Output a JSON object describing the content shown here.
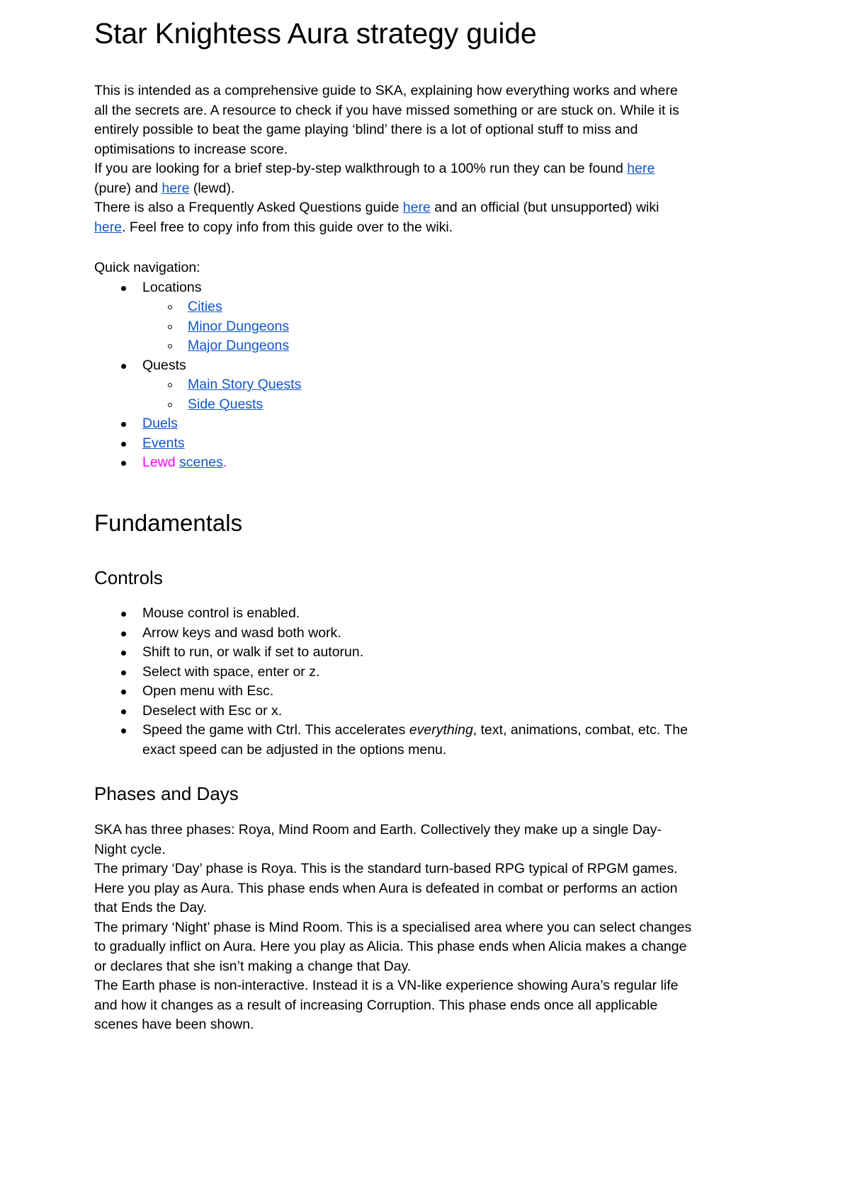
{
  "document": {
    "title": "Star Knightess Aura strategy guide",
    "intro": {
      "paragraph1": "This is intended as a comprehensive guide to SKA, explaining how everything works and where all the secrets are. A resource to check if you have missed something or are stuck on. While it is entirely possible to beat the game playing ‘blind’ there is a lot of optional stuff to miss and optimisations to increase score.",
      "walkthrough_pre": "If you are looking for a brief step-by-step walkthrough to a 100% run they can be found ",
      "walkthrough_link1": "here",
      "walkthrough_mid": " (pure) and ",
      "walkthrough_link2": "here",
      "walkthrough_post": " (lewd).",
      "faq_pre": "There is also a Frequently Asked Questions guide ",
      "faq_link": "here",
      "faq_mid": " and an official (but unsupported) wiki ",
      "wiki_link": "here",
      "faq_post": ". Feel free to copy info from this guide over to the wiki."
    },
    "quick_navigation": {
      "label": "Quick navigation:",
      "items": [
        {
          "label": "Locations",
          "is_link": false,
          "children": [
            {
              "label": "Cities",
              "is_link": true
            },
            {
              "label": "Minor Dungeons",
              "is_link": true
            },
            {
              "label": "Major Dungeons",
              "is_link": true
            }
          ]
        },
        {
          "label": "Quests",
          "is_link": false,
          "children": [
            {
              "label": "Main Story Quests",
              "is_link": true
            },
            {
              "label": "Side Quests",
              "is_link": true
            }
          ]
        },
        {
          "label": "Duels",
          "is_link": true,
          "children": []
        },
        {
          "label": "Events",
          "is_link": true,
          "children": []
        }
      ],
      "lewd_item": {
        "prefix": "Lewd ",
        "link": "scenes",
        "suffix": "."
      }
    },
    "fundamentals": {
      "heading": "Fundamentals",
      "controls": {
        "heading": "Controls",
        "items": [
          "Mouse control is enabled.",
          "Arrow keys and wasd both work.",
          "Shift to run, or walk if set to autorun.",
          "Select with space, enter or z.",
          "Open menu with Esc.",
          "Deselect with Esc or x."
        ],
        "speed_item": {
          "pre": "Speed the game with Ctrl. This accelerates ",
          "emphasis": "everything",
          "post": ", text, animations, combat, etc. The exact speed can be adjusted in the options menu."
        }
      },
      "phases": {
        "heading": "Phases and Days",
        "paragraph1": "SKA has three phases: Roya, Mind Room and Earth. Collectively they make up a single Day-Night cycle.",
        "paragraph2": "The primary ‘Day’ phase is Roya. This is the standard turn-based RPG typical of RPGM games. Here you play as Aura. This phase ends when Aura is defeated in combat or performs an action that Ends the Day.",
        "paragraph3": "The primary ‘Night’ phase is Mind Room. This is a specialised area where you can select changes to gradually inflict on Aura. Here you play as Alicia. This phase ends when Alicia makes a change or declares that she isn’t making a change that Day.",
        "paragraph4": "The Earth phase is non-interactive. Instead it is a VN-like experience showing Aura’s regular life and how it changes as a result of increasing Corruption. This phase ends once all applicable scenes have been shown."
      }
    },
    "colors": {
      "link": "#1155cc",
      "lewd": "#ff00ff",
      "text": "#000000",
      "background": "#ffffff"
    }
  }
}
